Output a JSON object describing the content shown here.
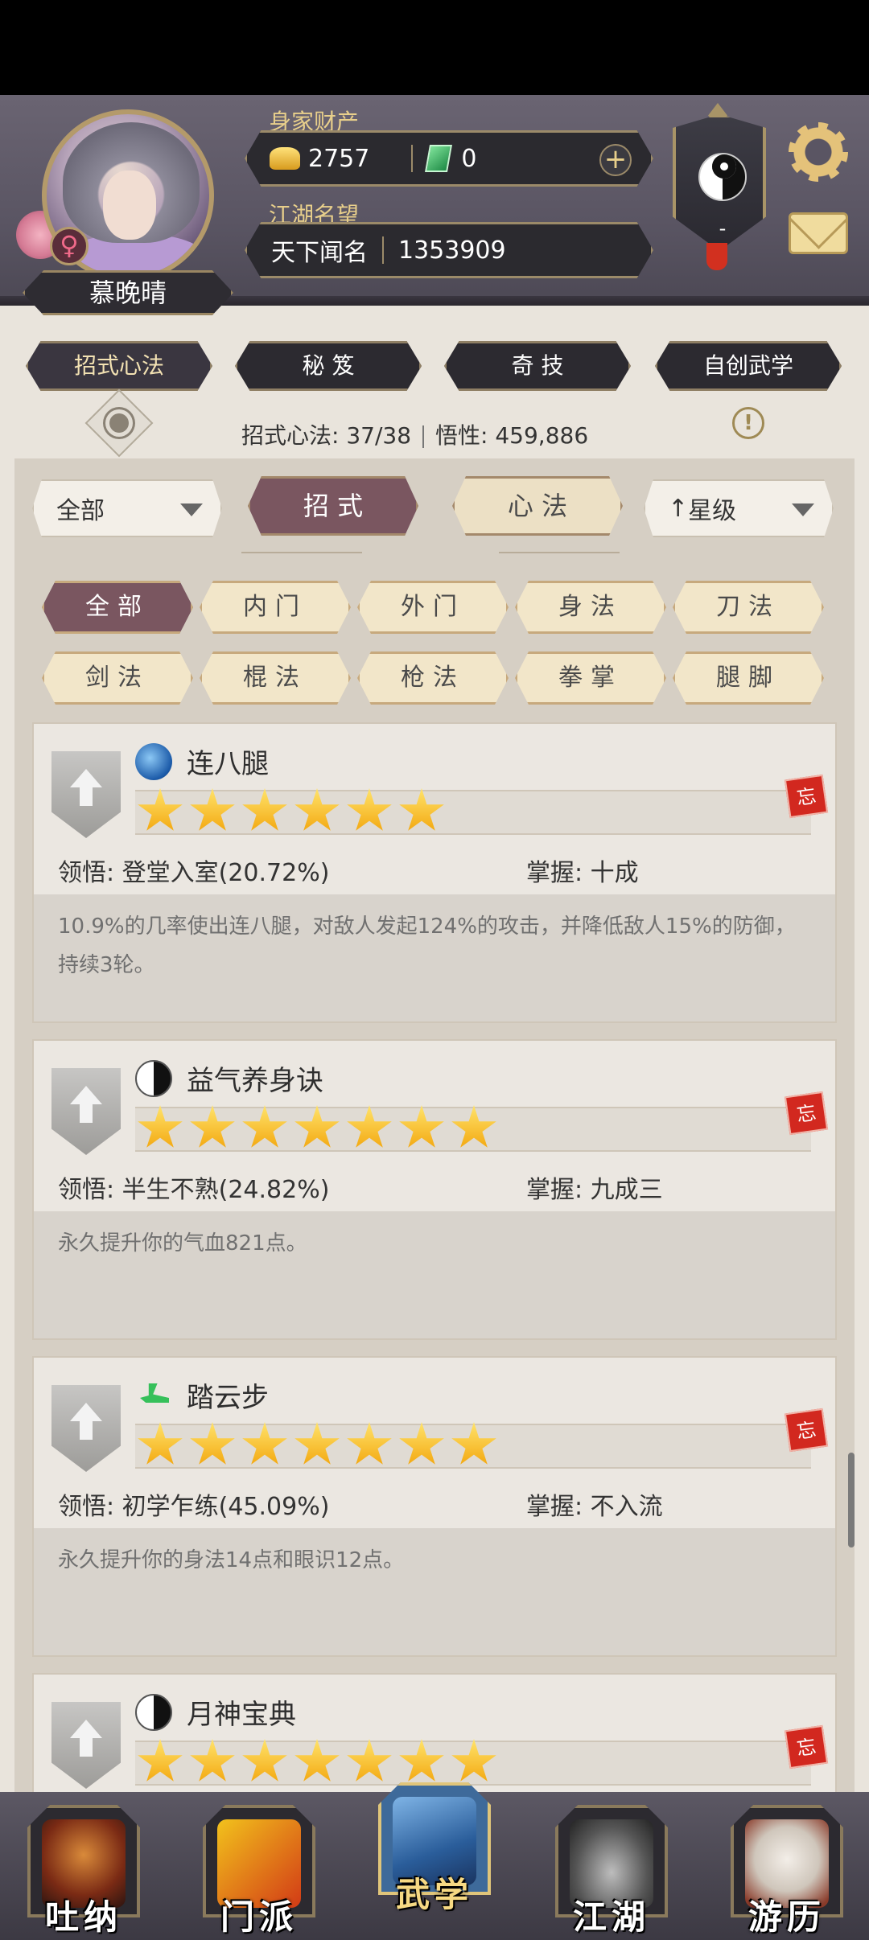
{
  "profile": {
    "name": "慕晚晴",
    "gender_symbol": "♀",
    "wealth_label": "身家财产",
    "gold": "2757",
    "jade": "0",
    "fame_label": "江湖名望",
    "fame_title": "天下闻名",
    "fame_value": "1353909",
    "rank": "-"
  },
  "tabs": [
    "招式心法",
    "秘 笈",
    "奇 技",
    "自创武学"
  ],
  "stats": {
    "moves_label": "招式心法: 37/38",
    "insight_label": "悟性: 459,886"
  },
  "filters": {
    "category": "全部",
    "mode_active": "招 式",
    "mode_inactive": "心 法",
    "sort": "星级",
    "chips": [
      "全部",
      "内门",
      "外门",
      "身法",
      "刀法",
      "剑法",
      "棍法",
      "枪法",
      "拳掌",
      "腿脚"
    ]
  },
  "skills": [
    {
      "name": "连八腿",
      "icon": "blue-orb-icon",
      "stars": 6,
      "comprehension": "领悟:  登堂入室(20.72%)",
      "mastery": "掌握:  十成",
      "desc": "10.9%的几率使出连八腿，对敌人发起124%的攻击，并降低敌人15%的防御，持续3轮。"
    },
    {
      "name": "益气养身诀",
      "icon": "yinyang-icon",
      "stars": 7,
      "comprehension": "领悟:  半生不熟(24.82%)",
      "mastery": "掌握:  九成三",
      "desc": "永久提升你的气血821点。"
    },
    {
      "name": "踏云步",
      "icon": "green-boot-icon",
      "stars": 7,
      "comprehension": "领悟:  初学乍练(45.09%)",
      "mastery": "掌握:  不入流",
      "desc": "永久提升你的身法14点和眼识12点。"
    },
    {
      "name": "月神宝典",
      "icon": "yinyang-icon",
      "stars": 7,
      "comprehension": "",
      "mastery": "",
      "desc": ""
    }
  ],
  "forget_stamp": "忘",
  "nav": [
    "吐纳",
    "门派",
    "武学",
    "江湖",
    "游历"
  ],
  "colors": {
    "active": "#7a5660",
    "gold_text": "#e8cf8b",
    "star": "#f2a40a"
  }
}
